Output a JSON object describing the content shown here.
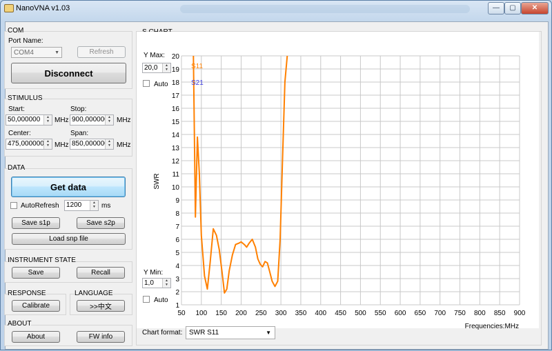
{
  "window": {
    "title": "NanoVNA v1.03",
    "minimize": "—",
    "maximize": "▢",
    "close": "✕"
  },
  "com": {
    "group": "COM",
    "port_label": "Port Name:",
    "port_value": "COM4",
    "refresh": "Refresh",
    "disconnect": "Disconnect"
  },
  "stimulus": {
    "group": "STIMULUS",
    "start_label": "Start:",
    "start_value": "50,000000",
    "stop_label": "Stop:",
    "stop_value": "900,000000",
    "center_label": "Center:",
    "center_value": "475,000000",
    "span_label": "Span:",
    "span_value": "850,000000",
    "unit": "MHz"
  },
  "data": {
    "group": "DATA",
    "get_data": "Get data",
    "autorefresh": "AutoRefresh",
    "interval": "1200",
    "interval_unit": "ms",
    "save_s1p": "Save s1p",
    "save_s2p": "Save s2p",
    "load_snp": "Load snp file"
  },
  "instrument": {
    "group": "INSTRUMENT STATE",
    "save": "Save",
    "recall": "Recall"
  },
  "response": {
    "group": "RESPONSE",
    "calibrate": "Calibrate"
  },
  "language": {
    "group": "LANGUAGE",
    "button": ">>中文"
  },
  "about": {
    "group": "ABOUT",
    "about": "About",
    "fw_info": "FW info"
  },
  "chart": {
    "panel_title": "S CHART",
    "ymax_label": "Y Max:",
    "ymax_value": "20,0",
    "ymin_label": "Y Min:",
    "ymin_value": "1,0",
    "auto_label": "Auto",
    "format_label": "Chart format:",
    "format_value": "SWR S11"
  },
  "chart_data": {
    "type": "line",
    "title": "",
    "xlabel": "Frequencies:MHz",
    "ylabel": "SWR",
    "xlim": [
      50,
      900
    ],
    "ylim": [
      1,
      20
    ],
    "x_ticks": [
      50,
      100,
      150,
      200,
      250,
      300,
      350,
      400,
      450,
      500,
      550,
      600,
      650,
      700,
      750,
      800,
      850,
      900
    ],
    "y_ticks": [
      1,
      2,
      3,
      4,
      5,
      6,
      7,
      8,
      9,
      10,
      11,
      12,
      13,
      14,
      15,
      16,
      17,
      18,
      19,
      20
    ],
    "grid": true,
    "legend": [
      "S11",
      "S21"
    ],
    "series": [
      {
        "name": "S11",
        "color": "#ff8000",
        "x": [
          80,
          85,
          90,
          95,
          100,
          108,
          115,
          122,
          130,
          138,
          145,
          152,
          158,
          164,
          170,
          178,
          186,
          194,
          200,
          208,
          214,
          220,
          228,
          236,
          242,
          248,
          254,
          260,
          266,
          272,
          278,
          285,
          292,
          298,
          304,
          310,
          316
        ],
        "y": [
          20,
          7.7,
          13.8,
          11,
          6.3,
          3.2,
          2.2,
          4.2,
          6.8,
          6.3,
          5.2,
          3.5,
          1.9,
          2.2,
          3.6,
          4.8,
          5.6,
          5.7,
          5.8,
          5.6,
          5.4,
          5.7,
          6,
          5.4,
          4.5,
          4.1,
          3.9,
          4.3,
          4.2,
          3.5,
          2.8,
          2.4,
          2.8,
          6,
          12,
          18,
          20
        ]
      }
    ]
  }
}
